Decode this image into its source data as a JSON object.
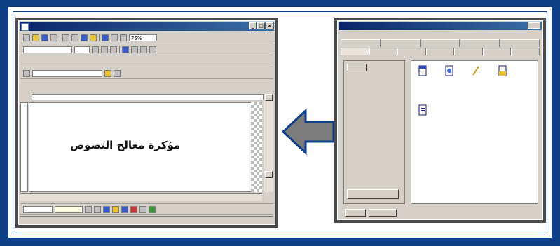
{
  "word_window": {
    "document_text": "مؤكرة معالج النصوص",
    "zoom": "75%"
  },
  "colors": {
    "frame": "#0d3f86",
    "titlebar": "#0a246a",
    "face": "#d4d0c8"
  }
}
